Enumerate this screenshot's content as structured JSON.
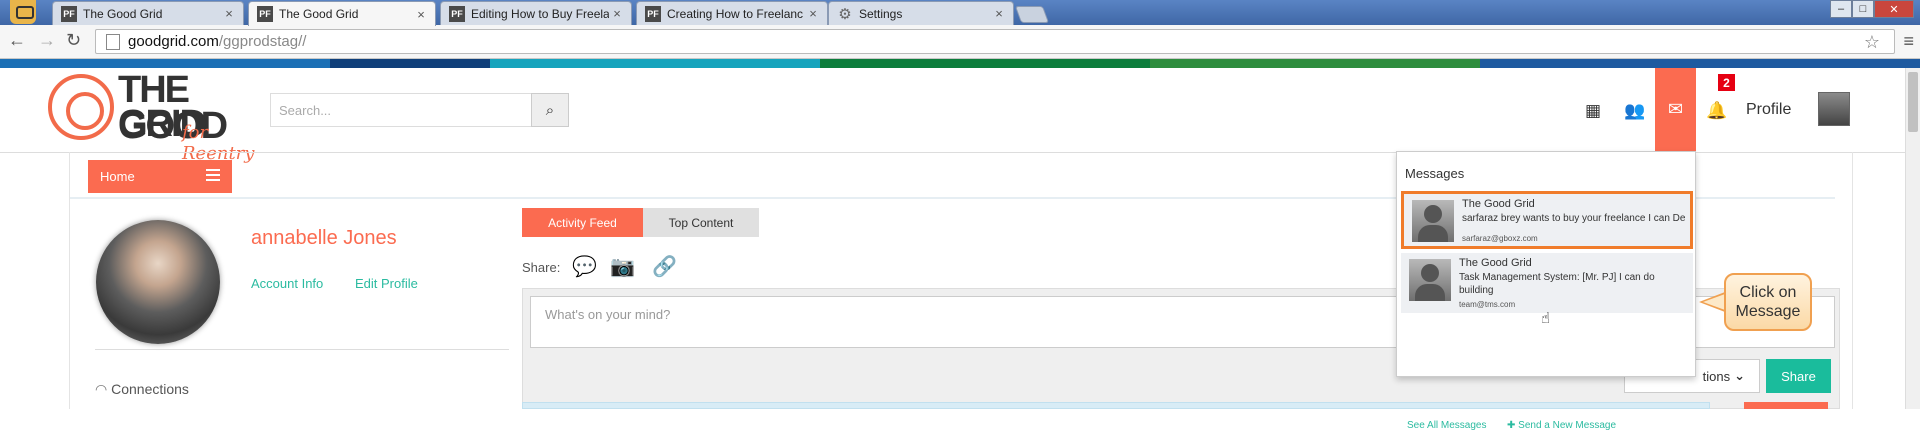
{
  "browser": {
    "tabs": [
      {
        "favicon": "PF",
        "title": "The Good Grid",
        "active": false
      },
      {
        "favicon": "PF",
        "title": "The Good Grid",
        "active": true
      },
      {
        "favicon": "PF",
        "title": "Editing How to Buy Freela",
        "active": false
      },
      {
        "favicon": "PF",
        "title": "Creating How to Freelanc",
        "active": false
      },
      {
        "favicon": "gear-icon",
        "title": "Settings",
        "active": false
      }
    ],
    "close_glyph": "×",
    "url_host": "goodgrid.com",
    "url_path": "/ggprodstag//"
  },
  "header": {
    "logo_line1": "THE GOOD",
    "logo_line2": "GRID",
    "logo_tagline": "for Reentry",
    "search_placeholder": "Search...",
    "notification_count": "2",
    "profile_label": "Profile"
  },
  "nav": {
    "home_label": "Home"
  },
  "user": {
    "name": "annabelle Jones",
    "account_info_label": "Account Info",
    "edit_profile_label": "Edit Profile",
    "connections_label": "Connections"
  },
  "feed": {
    "tabs": [
      "Activity Feed",
      "Top Content"
    ],
    "share_label": "Share:",
    "composer_placeholder": "What's on your mind?",
    "options_label": "tions",
    "share_button": "Share"
  },
  "messages": {
    "title": "Messages",
    "items": [
      {
        "sender": "The Good Grid",
        "body": "sarfaraz brey wants to buy your freelance I can De",
        "email": "sarfaraz@gboxz.com",
        "highlighted": true
      },
      {
        "sender": "The Good Grid",
        "body": "Task Management System: [Mr. PJ] I can do building",
        "email": "team@tms.com",
        "highlighted": false
      }
    ],
    "see_all": "See All Messages",
    "send_new": "Send a New Message"
  },
  "callout": {
    "text": "Click on Message"
  },
  "colors": {
    "accent": "#fb6b50",
    "teal": "#1abc9c",
    "link": "#2bbba0",
    "highlight_border": "#f07c2b",
    "strip": [
      "#1b6fb5",
      "#0f3f7a",
      "#16a4bd",
      "#0c7d3c",
      "#2e8d3e",
      "#1e5aa0"
    ]
  }
}
